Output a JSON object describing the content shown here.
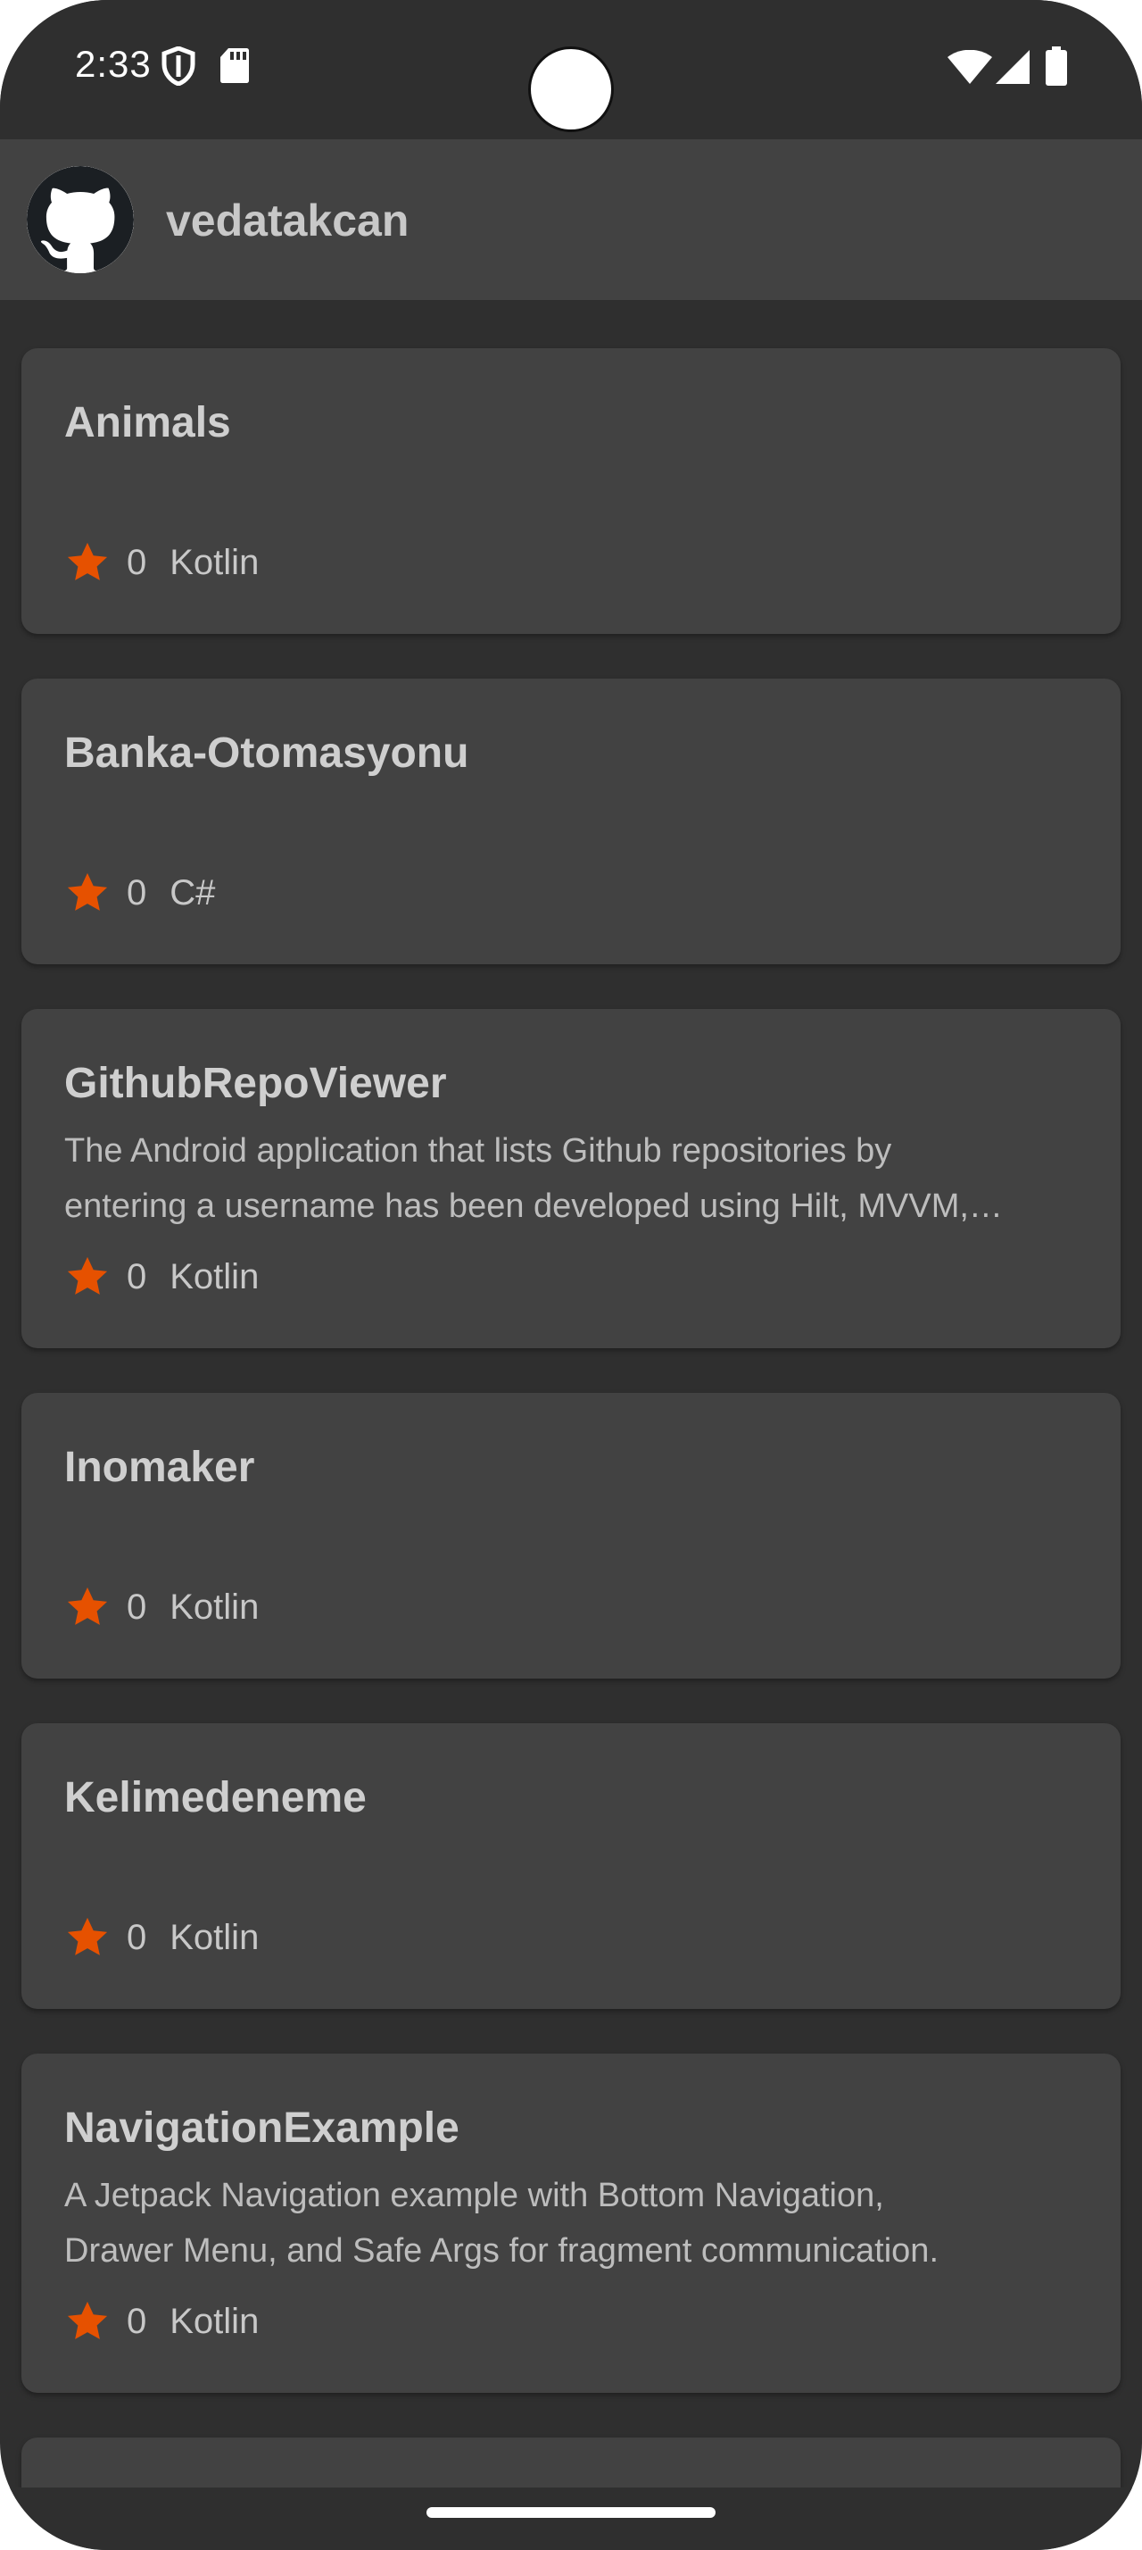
{
  "status_bar": {
    "time": "2:33",
    "icons": [
      "shield-icon",
      "sd-card-icon",
      "wifi-icon",
      "cellular-signal-icon",
      "battery-icon"
    ]
  },
  "app_bar": {
    "avatar_icon": "github-octocat-icon",
    "username": "vedatakcan"
  },
  "colors": {
    "background": "#2f2f2f",
    "card": "#424242",
    "star": "#e65100",
    "text": "#c8c8c8"
  },
  "repositories": [
    {
      "name": "Animals",
      "description": "",
      "stars": "0",
      "language": "Kotlin"
    },
    {
      "name": "Banka-Otomasyonu",
      "description": "",
      "stars": "0",
      "language": "C#"
    },
    {
      "name": "GithubRepoViewer",
      "description_lines": [
        "The Android application that lists Github repositories by",
        "entering a username has been developed using Hilt, MVVM,…"
      ],
      "stars": "0",
      "language": "Kotlin"
    },
    {
      "name": "Inomaker",
      "description": "",
      "stars": "0",
      "language": "Kotlin"
    },
    {
      "name": "Kelimedeneme",
      "description": "",
      "stars": "0",
      "language": "Kotlin"
    },
    {
      "name": "NavigationExample",
      "description_lines": [
        "A Jetpack Navigation example with Bottom Navigation,",
        "Drawer Menu, and Safe Args for fragment communication."
      ],
      "stars": "0",
      "language": "Kotlin"
    }
  ]
}
